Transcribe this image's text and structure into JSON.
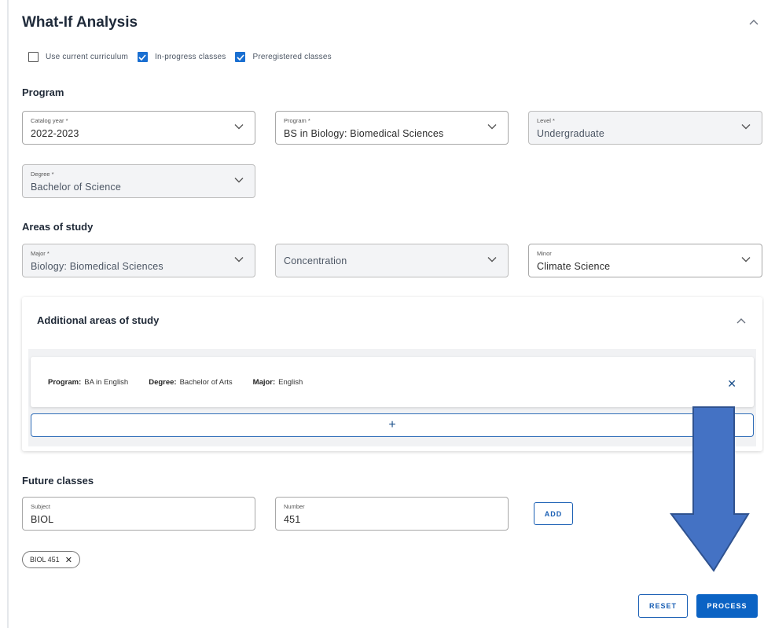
{
  "header": {
    "title": "What-If Analysis"
  },
  "options": [
    {
      "label": "Use current curriculum",
      "checked": false
    },
    {
      "label": "In-progress classes",
      "checked": true
    },
    {
      "label": "Preregistered classes",
      "checked": true
    }
  ],
  "program": {
    "section_title": "Program",
    "catalog_year": {
      "label": "Catalog year *",
      "value": "2022-2023"
    },
    "program": {
      "label": "Program *",
      "value": "BS in Biology: Biomedical Sciences"
    },
    "level": {
      "label": "Level *",
      "value": "Undergraduate"
    },
    "degree": {
      "label": "Degree *",
      "value": "Bachelor of Science"
    }
  },
  "areas": {
    "section_title": "Areas of study",
    "major": {
      "label": "Major *",
      "value": "Biology: Biomedical Sciences"
    },
    "concentration": {
      "placeholder": "Concentration"
    },
    "minor": {
      "label": "Minor",
      "value": "Climate Science"
    }
  },
  "additional": {
    "title": "Additional areas of study",
    "entry": {
      "program_label": "Program:",
      "program_value": "BA in English",
      "degree_label": "Degree:",
      "degree_value": "Bachelor of Arts",
      "major_label": "Major:",
      "major_value": "English",
      "remove_glyph": "✕"
    },
    "add_glyph": "+"
  },
  "future": {
    "section_title": "Future classes",
    "subject": {
      "label": "Subject",
      "value": "BIOL"
    },
    "number": {
      "label": "Number",
      "value": "451"
    },
    "add_label": "ADD",
    "chip": {
      "label": "BIOL 451",
      "remove_glyph": "✕"
    }
  },
  "actions": {
    "reset_label": "RESET",
    "process_label": "PROCESS"
  },
  "colors": {
    "accent": "#0b63c4",
    "arrow_fill": "#4472c4",
    "arrow_stroke": "#2f528f",
    "checkbox": "#1a6fd1"
  }
}
